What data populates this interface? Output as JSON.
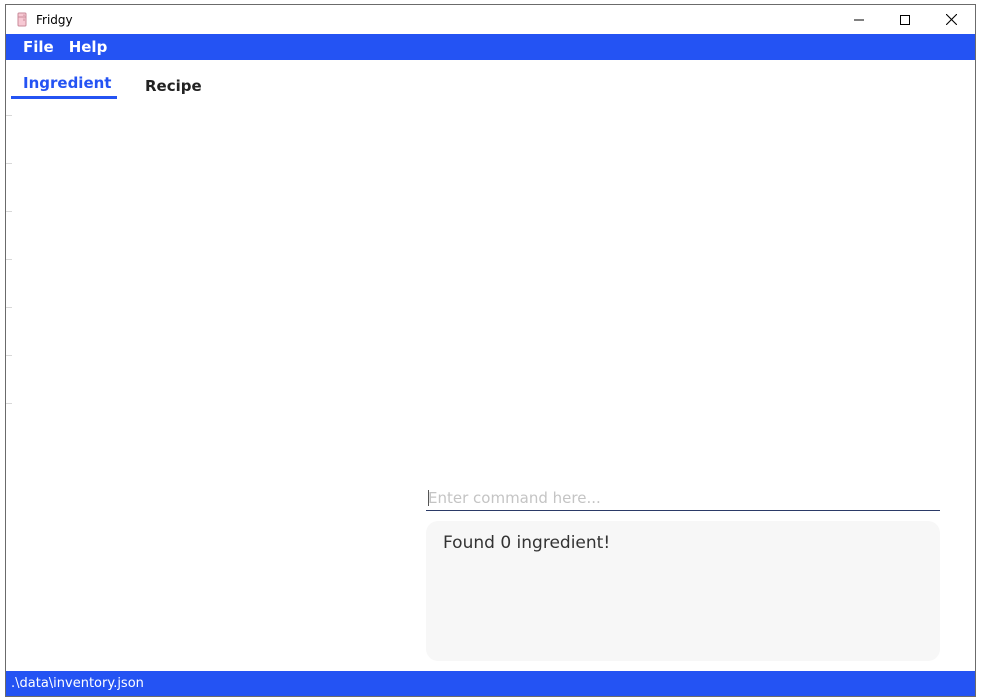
{
  "window": {
    "title": "Fridgy",
    "icon": "fridge-icon",
    "controls": {
      "minimize": "minimize-icon",
      "maximize": "maximize-icon",
      "close": "close-icon"
    }
  },
  "menu": {
    "items": [
      {
        "label": "File"
      },
      {
        "label": "Help"
      }
    ]
  },
  "tabs": [
    {
      "label": "Ingredient",
      "selected": true
    },
    {
      "label": "Recipe",
      "selected": false
    }
  ],
  "command": {
    "placeholder": "Enter command here...",
    "value": ""
  },
  "result": {
    "message": "Found 0 ingredient!"
  },
  "status": {
    "path": ".\\data\\inventory.json"
  },
  "colors": {
    "accent": "#2453f3",
    "result_background": "#f7f7f7",
    "input_underline": "#2b3a67"
  }
}
